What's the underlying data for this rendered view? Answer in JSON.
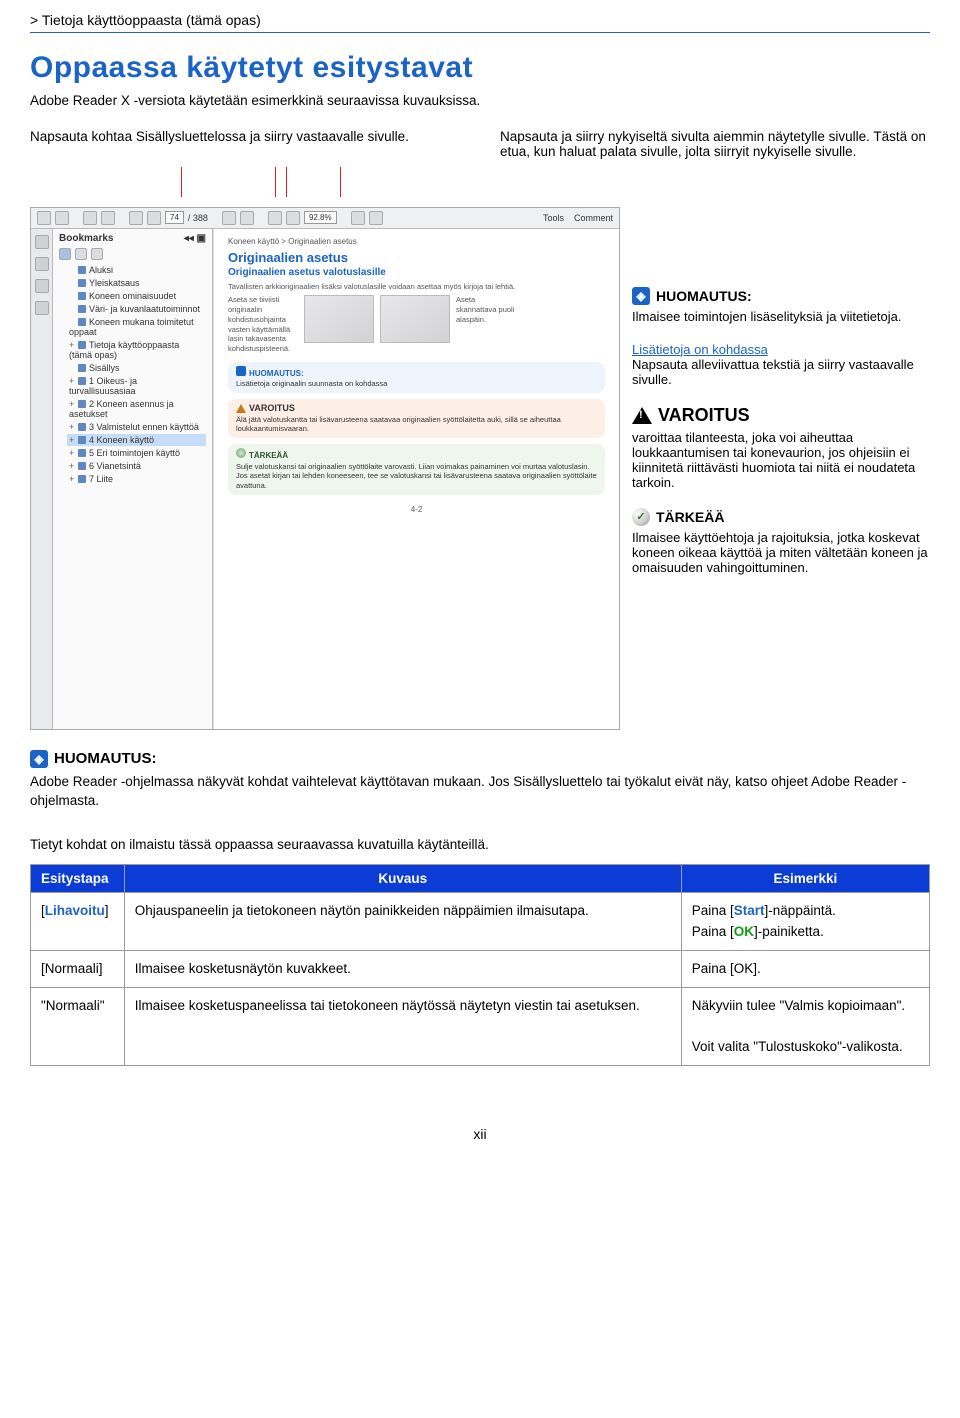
{
  "breadcrumb": "> Tietoja käyttöoppaasta (tämä opas)",
  "page_title": "Oppaassa käytetyt esitystavat",
  "intro": "Adobe Reader X -versiota käytetään esimerkkinä seuraavissa kuvauksissa.",
  "callout_left": "Napsauta kohtaa Sisällysluettelossa ja siirry vastaavalle sivulle.",
  "callout_right": "Napsauta ja siirry nykyiseltä sivulta aiemmin näytetylle sivulle. Tästä on etua, kun haluat palata sivulle, jolta siirryit nykyiselle sivulle.",
  "reader": {
    "toolbar": {
      "page_current": "74",
      "page_total": "/ 388",
      "zoom": "92.8%",
      "tools": "Tools",
      "comment": "Comment"
    },
    "bookmarks_title": "Bookmarks",
    "bookmarks": [
      {
        "label": "Aluksi",
        "exp": ""
      },
      {
        "label": "Yleiskatsaus",
        "exp": ""
      },
      {
        "label": "Koneen ominaisuudet",
        "exp": ""
      },
      {
        "label": "Väri- ja kuvanlaatutoiminnot",
        "exp": ""
      },
      {
        "label": "Koneen mukana toimitetut oppaat",
        "exp": ""
      },
      {
        "label": "Tietoja käyttöoppaasta (tämä opas)",
        "exp": "+"
      },
      {
        "label": "Sisällys",
        "exp": ""
      },
      {
        "label": "1 Oikeus- ja turvallisuusasiaa",
        "exp": "+"
      },
      {
        "label": "2 Koneen asennus ja asetukset",
        "exp": "+"
      },
      {
        "label": "3 Valmistelut ennen käyttöä",
        "exp": "+"
      },
      {
        "label": "4 Koneen käyttö",
        "exp": "+",
        "sel": true
      },
      {
        "label": "5 Eri toimintojen käyttö",
        "exp": "+"
      },
      {
        "label": "6 Vianetsintä",
        "exp": "+"
      },
      {
        "label": "7 Liite",
        "exp": "+"
      }
    ],
    "pg_crumb": "Koneen käyttö > Originaalien asetus",
    "pg_h1": "Originaalien asetus",
    "pg_h2": "Originaalien asetus valotuslasille",
    "pg_body": "Tavallisten arkkioriginaalien lisäksi valotuslasille voidaan asettaa myös kirjoja tai lehtiä.",
    "pg_ill_l1": "Aseta se tiiviisti originaalin kohdistusohjainta vasten käyttämällä lasin takavasenta kohdistuspisteenä.",
    "pg_ill_l2": "Aseta skannattava puoli alaspäin.",
    "note": {
      "hdr": "HUOMAUTUS:",
      "body": "Lisätietoja originaalin suunnasta on kohdassa"
    },
    "warn": {
      "hdr": "VAROITUS",
      "body": "Älä jätä valotuskantta tai lisävarusteena saatavaa originaalien syöttölaitetta auki, sillä se aiheuttaa loukkaantumisvaaran."
    },
    "imp": {
      "hdr": "TÄRKEÄÄ",
      "body": "Sulje valotuskansi tai originaalien syöttölaite varovasti. Liian voimakas painaminen voi murtaa valotuslasin.\nJos asetat kirjan tai lehden koneeseen, tee se valotuskansi tai lisävarusteena saatava originaalien syöttölaite avattuna."
    },
    "pagenum": "4-2"
  },
  "right_callouts": {
    "note": {
      "head": "HUOMAUTUS:",
      "body": "Ilmaisee toimintojen lisäselityksiä ja viitetietoja."
    },
    "link": {
      "link_text": "Lisätietoja on kohdassa",
      "body": "Napsauta alleviivattua tekstiä ja siirry vastaavalle sivulle."
    },
    "warn": {
      "head": "VAROITUS",
      "body": "varoittaa tilanteesta, joka voi aiheuttaa loukkaantumisen tai konevaurion, jos ohjeisiin ei kiinnitetä riittävästi huomiota tai niitä ei noudateta tarkoin."
    },
    "imp": {
      "head": "TÄRKEÄÄ",
      "body": "Ilmaisee käyttöehtoja ja rajoituksia, jotka koskevat koneen oikeaa käyttöä ja miten vältetään koneen ja omaisuuden vahingoittuminen."
    }
  },
  "note_main": {
    "head": "HUOMAUTUS:",
    "body": "Adobe Reader -ohjelmassa näkyvät kohdat vaihtelevat käyttötavan mukaan. Jos Sisällysluettelo tai työkalut eivät näy, katso ohjeet Adobe Reader -ohjelmasta."
  },
  "table_intro": "Tietyt kohdat on ilmaistu tässä oppaassa seuraavassa kuvatuilla käytänteillä.",
  "table": {
    "headers": [
      "Esitystapa",
      "Kuvaus",
      "Esimerkki"
    ],
    "rows": [
      {
        "c1_pre": "[",
        "c1_b": "Lihavoitu",
        "c1_post": "]",
        "c2": "Ohjauspaneelin ja tietokoneen näytön painikkeiden näppäimien ilmaisutapa.",
        "c3_l1_pre": "Paina [",
        "c3_l1_b": "Start",
        "c3_l1_post": "]-näppäintä.",
        "c3_l2_pre": "Paina [",
        "c3_l2_b": "OK",
        "c3_l2_post": "]-painiketta."
      },
      {
        "c1": "[Normaali]",
        "c2": "Ilmaisee kosketusnäytön kuvakkeet.",
        "c3": "Paina [OK]."
      },
      {
        "c1": "\"Normaali\"",
        "c2": "Ilmaisee kosketuspaneelissa tai tietokoneen näytössä näytetyn viestin tai asetuksen.",
        "c3_l1": "Näkyviin tulee \"Valmis kopioimaan\".",
        "c3_l2": "Voit valita \"Tulostuskoko\"-valikosta."
      }
    ]
  },
  "footer": "xii"
}
